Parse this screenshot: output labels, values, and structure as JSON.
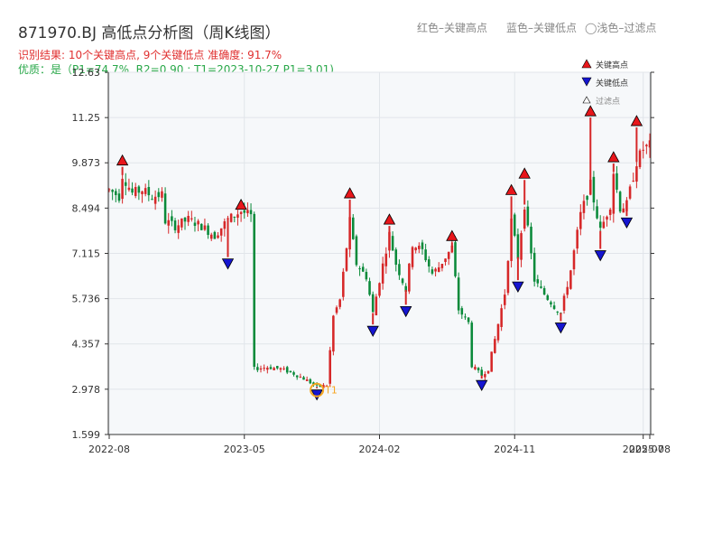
{
  "header": {
    "title": "871970.BJ 高低点分析图（周K线图）",
    "legend_red": "红色–关键高点",
    "legend_blue": "蓝色–关键低点",
    "legend_filtered": "◯浅色–过滤点",
    "result_line": "识别结果: 10个关键高点, 9个关键低点   准确度: 91.7%",
    "quality_line": "优质：是（P1=74.7%, R2=0.90 ; T1=2023-10-27 P1=3.01)"
  },
  "colors": {
    "up": "#d62728",
    "down": "#0a8a3a",
    "high_marker": "#e8161b",
    "low_marker": "#1515d0",
    "t1": "#f5a623"
  },
  "chart_data": {
    "type": "candlestick",
    "y_ticks": [
      "12.63",
      "11.25",
      "9.873",
      "8.494",
      "7.115",
      "5.736",
      "4.357",
      "2.978",
      "1.599"
    ],
    "x_ticks": [
      "2022-08",
      "2023-05",
      "2024-02",
      "2024-11",
      "2025-07",
      "2025-08"
    ],
    "ylim": [
      1.599,
      12.63
    ],
    "xlim": [
      0,
      164
    ],
    "x_tick_positions": [
      0,
      41,
      82,
      123,
      162,
      164
    ],
    "legend": {
      "high": "关键高点",
      "low": "关键低点",
      "filtered": "过滤点"
    },
    "t1_label": "T1",
    "t1_point": {
      "x": 63,
      "y": 3.01
    },
    "key_highs": [
      {
        "x": 4,
        "y": 9.75
      },
      {
        "x": 40,
        "y": 8.4
      },
      {
        "x": 73,
        "y": 8.75
      },
      {
        "x": 85,
        "y": 7.95
      },
      {
        "x": 104,
        "y": 7.45
      },
      {
        "x": 122,
        "y": 8.85
      },
      {
        "x": 126,
        "y": 9.35
      },
      {
        "x": 146,
        "y": 11.25
      },
      {
        "x": 153,
        "y": 9.85
      },
      {
        "x": 160,
        "y": 10.95
      }
    ],
    "key_lows": [
      {
        "x": 36,
        "y": 7.0
      },
      {
        "x": 63,
        "y": 3.01
      },
      {
        "x": 80,
        "y": 4.95
      },
      {
        "x": 90,
        "y": 5.55
      },
      {
        "x": 113,
        "y": 3.3
      },
      {
        "x": 124,
        "y": 6.3
      },
      {
        "x": 137,
        "y": 5.05
      },
      {
        "x": 149,
        "y": 7.25
      },
      {
        "x": 157,
        "y": 8.25
      }
    ],
    "price_path": [
      [
        0,
        9.05
      ],
      [
        3,
        8.85
      ],
      [
        4,
        9.5
      ],
      [
        7,
        8.95
      ],
      [
        10,
        9.05
      ],
      [
        13,
        8.85
      ],
      [
        16,
        8.9
      ],
      [
        17,
        8.1
      ],
      [
        20,
        7.95
      ],
      [
        24,
        8.15
      ],
      [
        28,
        7.95
      ],
      [
        32,
        7.65
      ],
      [
        36,
        8.15
      ],
      [
        40,
        8.4
      ],
      [
        43,
        8.25
      ],
      [
        44,
        3.6
      ],
      [
        48,
        3.65
      ],
      [
        52,
        3.6
      ],
      [
        56,
        3.45
      ],
      [
        60,
        3.25
      ],
      [
        63,
        3.05
      ],
      [
        66,
        3.1
      ],
      [
        68,
        5.2
      ],
      [
        70,
        5.7
      ],
      [
        73,
        8.1
      ],
      [
        75,
        6.8
      ],
      [
        78,
        6.4
      ],
      [
        80,
        5.3
      ],
      [
        82,
        6.3
      ],
      [
        85,
        7.7
      ],
      [
        87,
        6.8
      ],
      [
        90,
        6.0
      ],
      [
        92,
        7.4
      ],
      [
        95,
        7.2
      ],
      [
        98,
        6.5
      ],
      [
        100,
        6.7
      ],
      [
        104,
        7.3
      ],
      [
        106,
        5.4
      ],
      [
        109,
        5.0
      ],
      [
        110,
        3.7
      ],
      [
        113,
        3.4
      ],
      [
        115,
        3.6
      ],
      [
        117,
        4.5
      ],
      [
        120,
        5.9
      ],
      [
        122,
        8.1
      ],
      [
        124,
        7.0
      ],
      [
        126,
        8.6
      ],
      [
        129,
        6.3
      ],
      [
        131,
        6.0
      ],
      [
        135,
        5.5
      ],
      [
        137,
        5.3
      ],
      [
        140,
        6.6
      ],
      [
        143,
        8.3
      ],
      [
        146,
        9.2
      ],
      [
        149,
        7.8
      ],
      [
        152,
        8.6
      ],
      [
        153,
        9.6
      ],
      [
        155,
        8.5
      ],
      [
        157,
        8.6
      ],
      [
        160,
        9.9
      ],
      [
        162,
        10.3
      ],
      [
        164,
        10.4
      ]
    ]
  }
}
